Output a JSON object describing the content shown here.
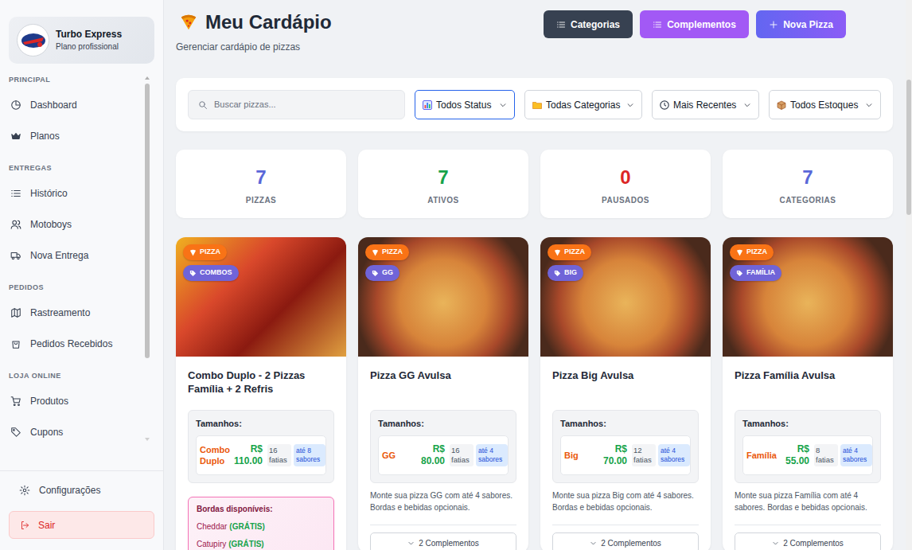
{
  "sidebar": {
    "brand": {
      "name": "Turbo Express",
      "plan": "Plano profissional"
    },
    "sections": [
      {
        "title": "PRINCIPAL",
        "items": [
          {
            "label": "Dashboard"
          },
          {
            "label": "Planos"
          }
        ]
      },
      {
        "title": "ENTREGAS",
        "items": [
          {
            "label": "Histórico"
          },
          {
            "label": "Motoboys"
          },
          {
            "label": "Nova Entrega"
          }
        ]
      },
      {
        "title": "PEDIDOS",
        "items": [
          {
            "label": "Rastreamento"
          },
          {
            "label": "Pedidos Recebidos"
          }
        ]
      },
      {
        "title": "LOJA ONLINE",
        "items": [
          {
            "label": "Produtos"
          },
          {
            "label": "Cupons"
          }
        ]
      }
    ],
    "footer": [
      {
        "label": "Configurações"
      },
      {
        "label": "Sair"
      }
    ]
  },
  "header": {
    "title": "Meu Cardápio",
    "subtitle": "Gerenciar cardápio de pizzas",
    "buttons": [
      {
        "label": "Categorias"
      },
      {
        "label": "Complementos"
      },
      {
        "label": "Nova Pizza"
      }
    ]
  },
  "filters": {
    "search": {
      "placeholder": "Buscar pizzas..."
    },
    "selects": [
      {
        "label": "Todos Status",
        "focused": true
      },
      {
        "label": "Todas Categorias",
        "focused": false
      },
      {
        "label": "Mais Recentes",
        "focused": false
      },
      {
        "label": "Todos Estoques",
        "focused": false
      }
    ]
  },
  "stats": [
    {
      "value": "7",
      "label": "PIZZAS",
      "color": "#5a67d8"
    },
    {
      "value": "7",
      "label": "ATIVOS",
      "color": "#16a34a"
    },
    {
      "value": "0",
      "label": "PAUSADOS",
      "color": "#dc2626"
    },
    {
      "value": "7",
      "label": "CATEGORIAS",
      "color": "#5a67d8"
    }
  ],
  "cards": [
    {
      "kind": "combo",
      "badges": [
        {
          "label": "PIZZA",
          "color": "#f97316"
        },
        {
          "label": "COMBOS",
          "color": "#7064d8"
        }
      ],
      "title": "Combo Duplo - 2 Pizzas Família + 2 Refris",
      "sizes_title": "Tamanhos:",
      "sizes": [
        {
          "name": "Combo Duplo",
          "price": "R$ 110.00",
          "slices": "16 fatias",
          "flavors": "até 8 sabores"
        }
      ],
      "borders": {
        "title": "Bordas disponíveis:",
        "items": [
          {
            "name": "Cheddar",
            "note": "(GRÁTIS)"
          },
          {
            "name": "Catupiry",
            "note": "(GRÁTIS)"
          }
        ]
      }
    },
    {
      "kind": "single",
      "badges": [
        {
          "label": "PIZZA",
          "color": "#f97316"
        },
        {
          "label": "GG",
          "color": "#7064d8"
        }
      ],
      "title": "Pizza GG Avulsa",
      "sizes_title": "Tamanhos:",
      "sizes": [
        {
          "name": "GG",
          "price": "R$ 80.00",
          "slices": "16 fatias",
          "flavors": "até 4 sabores"
        }
      ],
      "description": "Monte sua pizza GG com até 4 sabores. Bordas e bebidas opcionais.",
      "complements": "2 Complementos"
    },
    {
      "kind": "single",
      "badges": [
        {
          "label": "PIZZA",
          "color": "#f97316"
        },
        {
          "label": "BIG",
          "color": "#7064d8"
        }
      ],
      "title": "Pizza Big Avulsa",
      "sizes_title": "Tamanhos:",
      "sizes": [
        {
          "name": "Big",
          "price": "R$ 70.00",
          "slices": "12 fatias",
          "flavors": "até 4 sabores"
        }
      ],
      "description": "Monte sua pizza Big com até 4 sabores. Bordas e bebidas opcionais.",
      "complements": "2 Complementos"
    },
    {
      "kind": "single",
      "badges": [
        {
          "label": "PIZZA",
          "color": "#f97316"
        },
        {
          "label": "FAMÍLIA",
          "color": "#7064d8"
        }
      ],
      "title": "Pizza Família Avulsa",
      "sizes_title": "Tamanhos:",
      "sizes": [
        {
          "name": "Família",
          "price": "R$ 55.00",
          "slices": "8 fatias",
          "flavors": "até 4 sabores"
        }
      ],
      "description": "Monte sua pizza Família com até 4 sabores. Bordas e bebidas opcionais.",
      "complements": "2 Complementos"
    }
  ]
}
